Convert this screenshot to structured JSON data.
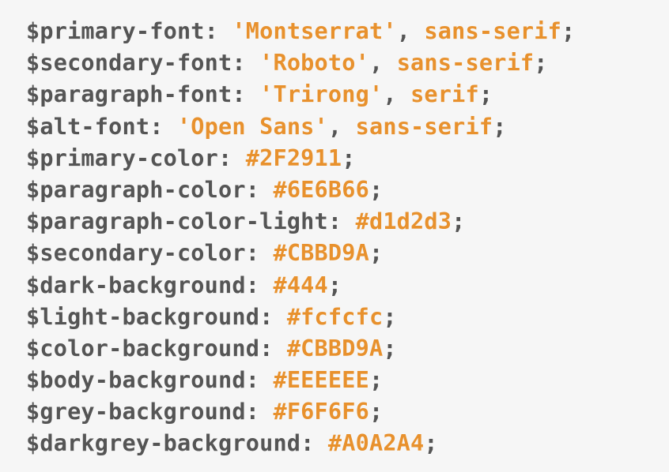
{
  "code": {
    "lines": [
      {
        "name": "$primary-font",
        "value": "'Montserrat'",
        "suffix": ", ",
        "value2": "sans-serif"
      },
      {
        "name": "$secondary-font",
        "value": "'Roboto'",
        "suffix": ", ",
        "value2": "sans-serif"
      },
      {
        "name": "$paragraph-font",
        "value": "'Trirong'",
        "suffix": ", ",
        "value2": "serif"
      },
      {
        "name": "$alt-font",
        "value": "'Open Sans'",
        "suffix": ", ",
        "value2": "sans-serif"
      },
      {
        "name": "$primary-color",
        "value": "#2F2911"
      },
      {
        "name": "$paragraph-color",
        "value": "#6E6B66"
      },
      {
        "name": "$paragraph-color-light",
        "value": "#d1d2d3"
      },
      {
        "name": "$secondary-color",
        "value": "#CBBD9A"
      },
      {
        "name": "$dark-background",
        "value": "#444"
      },
      {
        "name": "$light-background",
        "value": "#fcfcfc"
      },
      {
        "name": "$color-background",
        "value": "#CBBD9A"
      },
      {
        "name": "$body-background",
        "value": "#EEEEEE"
      },
      {
        "name": "$grey-background",
        "value": "#F6F6F6"
      },
      {
        "name": "$darkgrey-background",
        "value": "#A0A2A4"
      }
    ],
    "separator": ": ",
    "terminator": ";"
  },
  "colors": {
    "background": "#f6f6f6",
    "variable": "#555555",
    "value": "#e8912d"
  }
}
